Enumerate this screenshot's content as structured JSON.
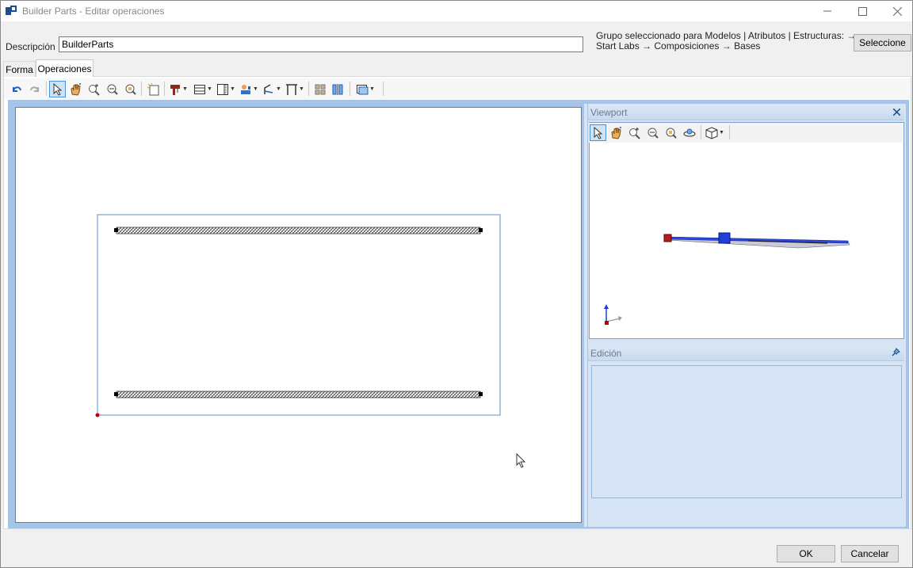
{
  "window": {
    "title": "Builder Parts - Editar operaciones",
    "controls": {
      "minimize_icon": "minimize-icon",
      "maximize_icon": "maximize-icon",
      "close_icon": "close-icon"
    }
  },
  "header": {
    "description_label": "Descripción",
    "description_value": "BuilderParts",
    "group_line1": "Grupo seleccionado para Modelos | Atributos | Estructuras: →",
    "group_line2": "Start Labs → Composiciones → Bases",
    "select_button": "Seleccione"
  },
  "tabs": [
    {
      "label": "Forma",
      "active": false
    },
    {
      "label": "Operaciones",
      "active": true
    }
  ],
  "toolbar": {
    "icons": [
      "undo-icon",
      "redo-icon",
      "select-pointer-icon",
      "pan-hand-icon",
      "zoom-in-icon",
      "zoom-out-icon",
      "zoom-extents-icon",
      "new-operation-icon",
      "drill-icon",
      "shelf-icon",
      "panel-icon",
      "tool-icon",
      "path-icon",
      "frame-icon",
      "group-icon",
      "align-icon",
      "view-mode-icon"
    ]
  },
  "viewport_panel": {
    "title": "Viewport",
    "icons": [
      "select-pointer-icon",
      "pan-hand-icon",
      "zoom-in-icon",
      "zoom-out-icon",
      "zoom-extents-icon",
      "orbit-icon",
      "view-cube-icon"
    ]
  },
  "edit_panel": {
    "title": "Edición"
  },
  "footer": {
    "ok_button": "OK",
    "cancel_button": "Cancelar"
  },
  "colors": {
    "accent": "#4a90d9",
    "workspace_bg": "#a6c3e8",
    "panel_bg": "#d6e4f5",
    "selection_outline": "#5b8fc7",
    "origin_marker": "#c00000",
    "model_blue": "#1f3fd9"
  }
}
